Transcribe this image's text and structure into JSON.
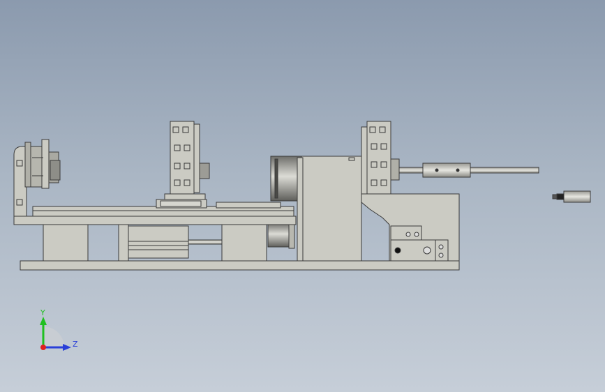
{
  "triad": {
    "y_label": "Y",
    "z_label": "Z",
    "colors": {
      "y": "#20c020",
      "z": "#2a3fd8",
      "x": "#e02020"
    }
  },
  "colors": {
    "part_fill": "#cbcbc3",
    "part_stroke": "#3a3a3a",
    "motor_dark": "#8c8c86"
  }
}
